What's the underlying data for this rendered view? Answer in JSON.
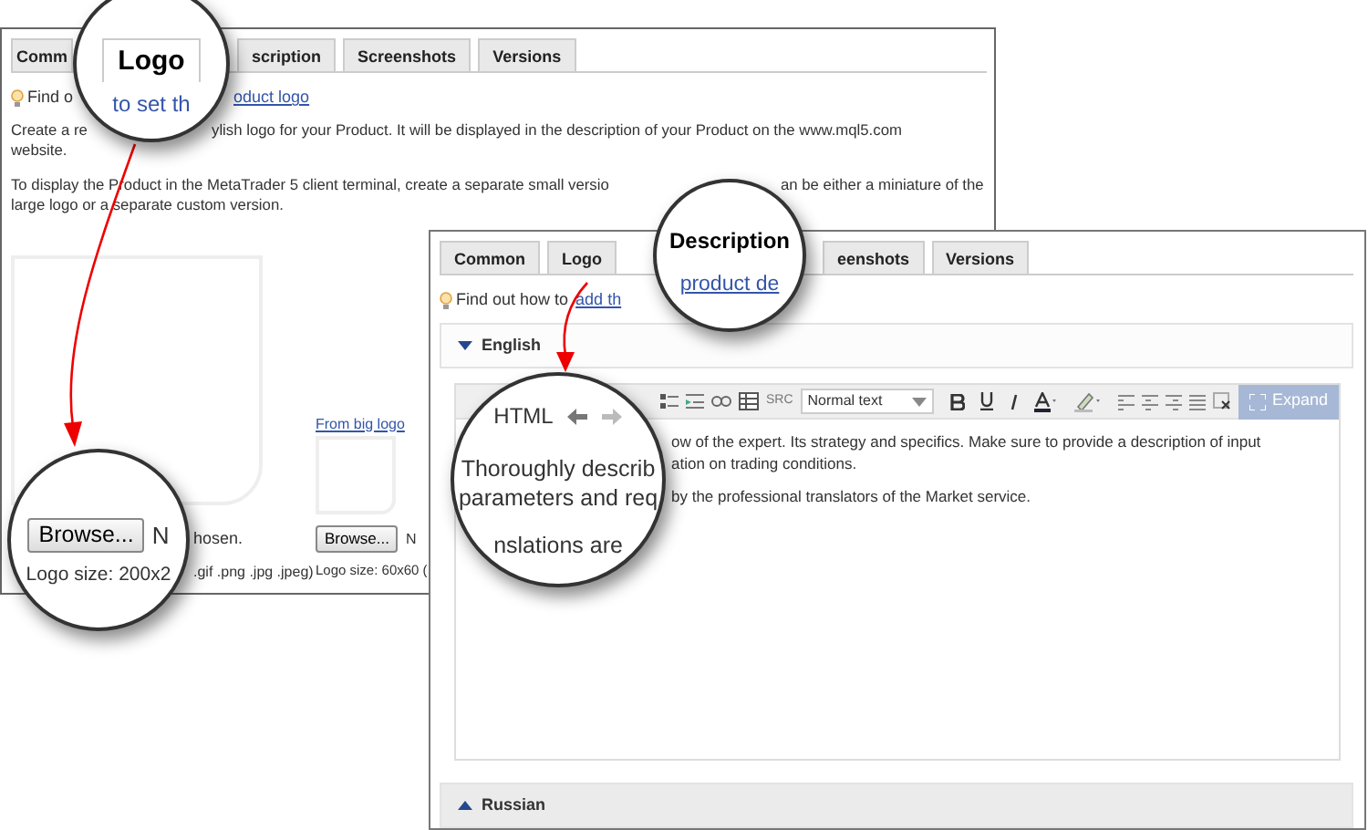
{
  "back_panel": {
    "tabs": [
      {
        "label": "Comm",
        "selected": false
      },
      {
        "label": "Logo",
        "selected": true
      },
      {
        "label": "scription",
        "selected": false
      },
      {
        "label": "Screenshots",
        "selected": false
      },
      {
        "label": "Versions",
        "selected": false
      }
    ],
    "tip": {
      "text": "Find o",
      "link": "oduct logo",
      "magnified_link": "to set th"
    },
    "paragraphs": [
      [
        [
          "Create a re",
          "ylish logo for your Product. It will be displayed in the description of your Product on the www.mql5.com"
        ],
        [
          "website."
        ]
      ],
      [
        [
          "To display the Product in the MetaTrader 5 client terminal, create a separate small versio",
          "an be either a miniature of the"
        ],
        [
          "large logo or a separate custom version."
        ]
      ]
    ],
    "big_logo": {
      "browse_button": "Browse...",
      "file_status_magnified": "N",
      "file_status": "hosen.",
      "size_magnified": "Logo size: 200x2",
      "size": ".gif .png .jpg .jpeg)"
    },
    "small_logo": {
      "link": "From big logo",
      "browse_button": "Browse...",
      "file_status": "N",
      "size": "Logo size: 60x60 ("
    }
  },
  "front_panel": {
    "tabs": [
      {
        "label": "Common",
        "selected": false
      },
      {
        "label": "Logo",
        "selected": false
      },
      {
        "label": "Description",
        "selected": true
      },
      {
        "label": "eenshots",
        "selected": false
      },
      {
        "label": "Versions",
        "selected": false
      }
    ],
    "tip": {
      "text": "Find out how to",
      "link": "add th",
      "magnified_link": "product de"
    },
    "sections": [
      {
        "label": "English",
        "expanded": true
      },
      {
        "label": "Russian",
        "expanded": false
      }
    ],
    "editor": {
      "html_button": "HTML",
      "src_button": "SRC",
      "format_select": "Normal text",
      "expand_button": "Expand",
      "magnified_lines": [
        "Thoroughly describ",
        "parameters and req",
        "nslations are"
      ],
      "lines": [
        "ow of the expert. Its strategy and specifics. Make sure to provide a description of input",
        "ation on trading conditions.",
        "by the professional translators of the Market service."
      ]
    }
  }
}
